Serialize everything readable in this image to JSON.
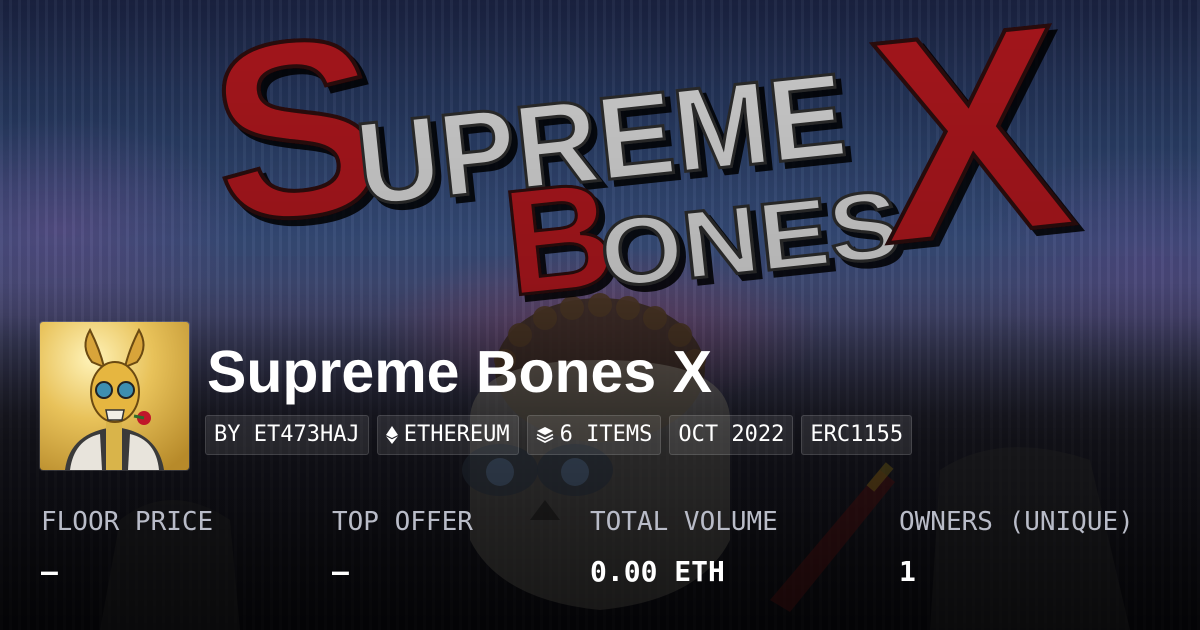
{
  "banner": {
    "logo_line1": "SUPREME",
    "logo_line2": "BONES",
    "logo_x": "X",
    "accent_red": "#a3141c",
    "logo_grey": "#c8c8c8"
  },
  "collection": {
    "title": "Supreme Bones X",
    "avatar_icon": "golden-horned-skull-with-rose"
  },
  "tags": {
    "creator": "BY ET473HAJ",
    "chain": "ETHEREUM",
    "chain_icon": "ethereum-icon",
    "items": "6 ITEMS",
    "items_icon": "layers-icon",
    "date": "OCT 2022",
    "standard": "ERC1155"
  },
  "stats": {
    "floor_price": {
      "label": "FLOOR PRICE",
      "value": "–"
    },
    "top_offer": {
      "label": "TOP OFFER",
      "value": "–"
    },
    "total_volume": {
      "label": "TOTAL VOLUME",
      "value": "0.00 ETH"
    },
    "owners": {
      "label": "OWNERS (UNIQUE)",
      "value": "1"
    }
  }
}
